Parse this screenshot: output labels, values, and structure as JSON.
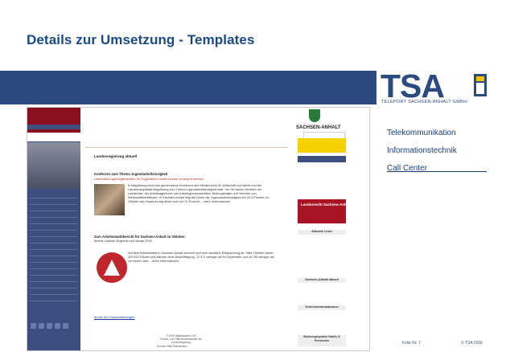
{
  "slide": {
    "title": "Details zur Umsetzung - Templates",
    "right_links": [
      "Telekommunikation",
      "Informationstechnik",
      "Call Center"
    ],
    "footer_folie": "Folie Nr. 7",
    "footer_copy": "© TSA 2006"
  },
  "logo": {
    "text": "TSA",
    "subtitle": "TELEPORT SACHSEN-ANHALT GMBH"
  },
  "screenshot": {
    "content": {
      "heading": "Landesregierung aktuell",
      "news1_title": "Konferenz zum Thema Jugendarbeitslosigkeit",
      "news1_sub": "Unterstützungsmöglichkeiten für Jugendliche sollen besser verknüpft werden",
      "news1_text": "In Magdeburg fand eine gemeinsame Konferenz des Ministeriums für Wirtschaft und Arbeit und der Landeshauptstadt Magdeburg zum Thema Jugendarbeitslosigkeit statt. Vor Ort waren Vertreter der Landkreise, der Arbeitsagenturen und Arbeitsgemeinschaften, Bildungsträger und Vertreter von Wirtschaftsverbänden. In Sachsen-Anhalt liegt die Quote der Jugendarbeitslosigkeit bei 16,3 Prozent, im Oktober des Vorjahres lag diese noch bei 21 Prozent. ...mehr Informationen",
      "news2_title": "Zum Arbeitsmarktbericht für Sachsen-Anhalt im Oktober:",
      "news2_sub": "Bereits Oktober-Ergebnis seit Januar 2005",
      "news2_text": "Auf dem Arbeitsmarkt in Sachsen-Anhalt zeichnet sich eine deutliche Entspannung ab. Mitte Oktober waren 209 820 Frauen und Männer ohne Beschäftigung, 12 571 weniger als im September und 16 735 weniger als vor einem Jahr. ...mehr Informationen",
      "archive_link": "Archiv der Pressemitteilungen",
      "footer_line1": "© 2005 Staatskanzlei LSA",
      "footer_line2": "Presse- und Öffentlichkeitsarbeit der Landesregierung",
      "footer_links": "Drucken   Hilfe   Datenschutz"
    },
    "right": {
      "state_name": "SACHSEN-ANHALT",
      "red_box_title": "Landesrecht Sachsen-Anhalt",
      "section1": "Aktuelle Links",
      "section2": "Sachsen-Anhalt aktuell",
      "section3": "Verkehrsinformationen",
      "bottom_box": "Buchungssystem Hotels & Pensionen"
    }
  }
}
